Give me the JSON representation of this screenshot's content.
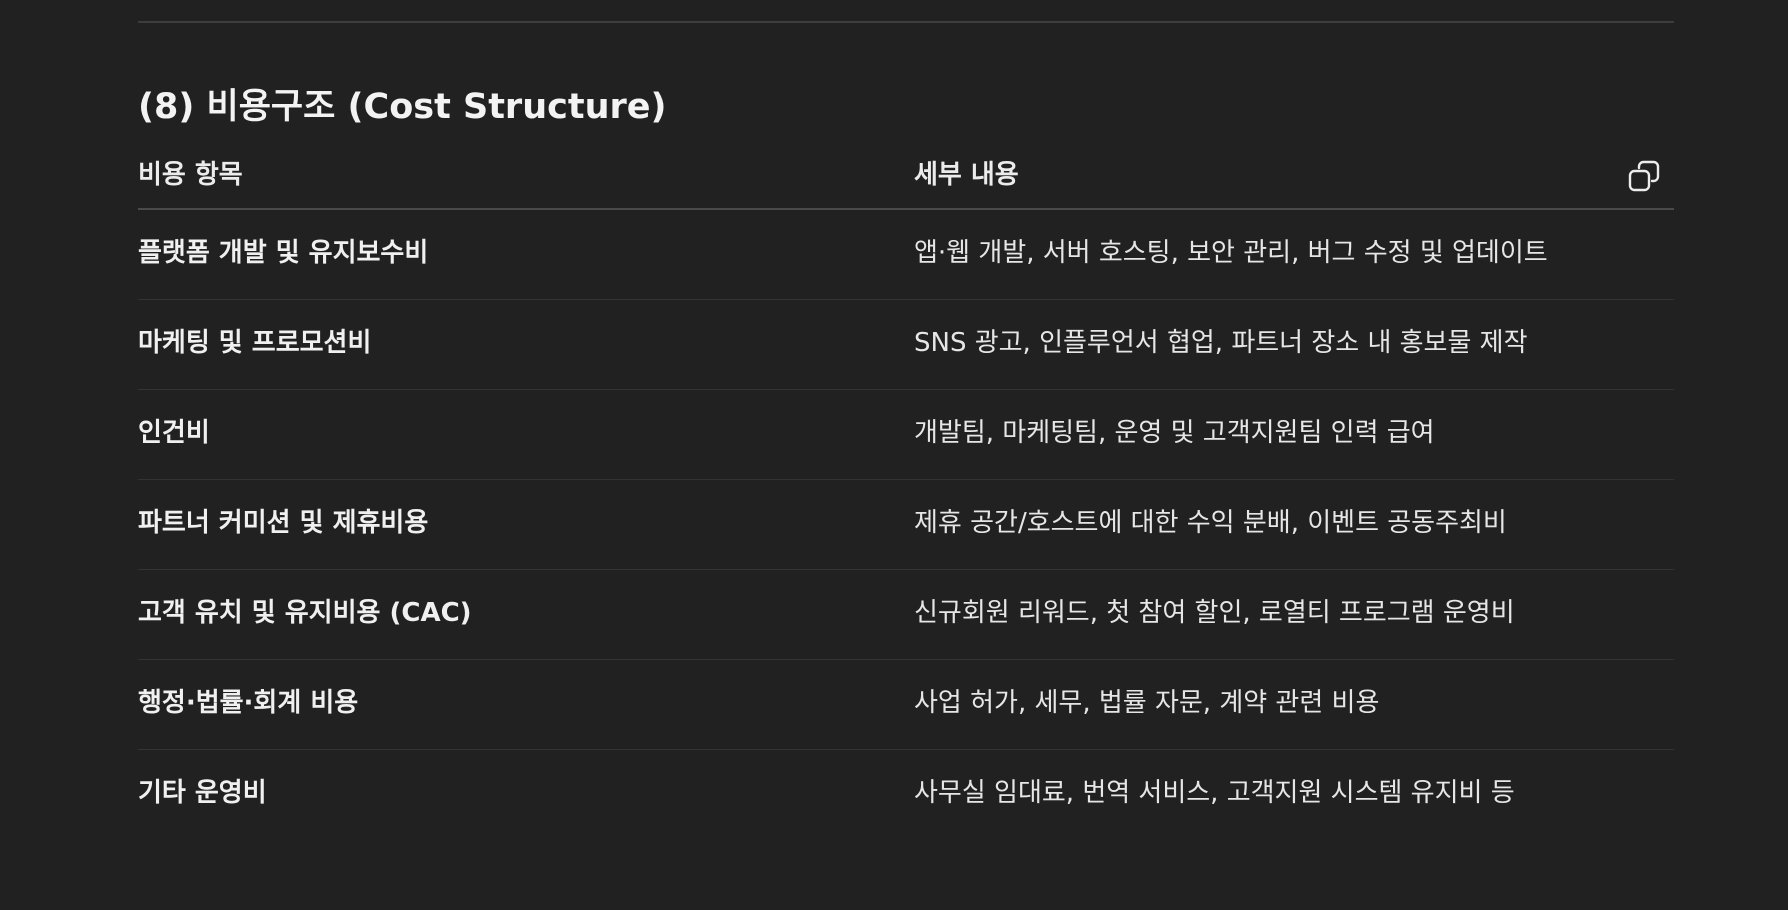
{
  "section": {
    "title": "(8) 비용구조 (Cost Structure)"
  },
  "table": {
    "headers": [
      "비용 항목",
      "세부 내용"
    ],
    "copy_icon": "copy-icon",
    "rows": [
      [
        "플랫폼 개발 및 유지보수비",
        "앱·웹 개발, 서버 호스팅, 보안 관리, 버그 수정 및 업데이트"
      ],
      [
        "마케팅 및 프로모션비",
        "SNS 광고, 인플루언서 협업, 파트너 장소 내 홍보물 제작"
      ],
      [
        "인건비",
        "개발팀, 마케팅팀, 운영 및 고객지원팀 인력 급여"
      ],
      [
        "파트너 커미션 및 제휴비용",
        "제휴 공간/호스트에 대한 수익 분배, 이벤트 공동주최비"
      ],
      [
        "고객 유치 및 유지비용 (CAC)",
        "신규회원 리워드, 첫 참여 할인, 로열티 프로그램 운영비"
      ],
      [
        "행정·법률·회계 비용",
        "사업 허가, 세무, 법률 자문, 계약 관련 비용"
      ],
      [
        "기타 운영비",
        "사무실 임대료, 번역 서비스, 고객지원 시스템 유지비 등"
      ]
    ]
  },
  "colors": {
    "background": "#212121",
    "text": "#ececec",
    "divider": "#3d3d3d"
  }
}
